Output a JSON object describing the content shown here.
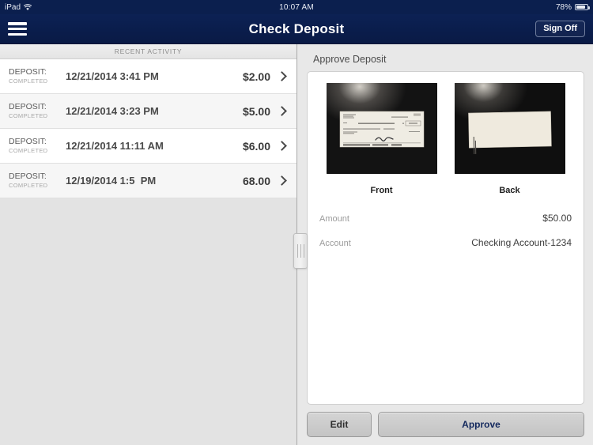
{
  "status_bar": {
    "device": "iPad",
    "wifi_icon": "wifi-icon",
    "time": "10:07 AM",
    "battery_percent": "78%",
    "battery_icon": "battery-icon"
  },
  "nav_bar": {
    "menu_icon": "hamburger-menu-icon",
    "title": "Check Deposit",
    "sign_off_label": "Sign Off"
  },
  "left_pane": {
    "section_header": "RECENT ACTIVITY",
    "rows": [
      {
        "type": "DEPOSIT:",
        "state": "COMPLETED",
        "date": "12/21/2014 3:41 PM",
        "amount": "$2.00",
        "chevron_icon": "chevron-right-icon"
      },
      {
        "type": "DEPOSIT:",
        "state": "COMPLETED",
        "date": "12/21/2014 3:23 PM",
        "amount": "$5.00",
        "chevron_icon": "chevron-right-icon"
      },
      {
        "type": "DEPOSIT:",
        "state": "COMPLETED",
        "date": "12/21/2014 11:11 AM",
        "amount": "$6.00",
        "chevron_icon": "chevron-right-icon"
      },
      {
        "type": "DEPOSIT:",
        "state": "COMPLETED",
        "date": "12/19/2014 1:5  PM",
        "amount": "68.00",
        "chevron_icon": "chevron-right-icon"
      }
    ]
  },
  "splitter": {
    "icon": "drag-handle-icon"
  },
  "right_pane": {
    "title": "Approve Deposit",
    "thumbnails": [
      {
        "label": "Front",
        "image_name": "check-front-image"
      },
      {
        "label": "Back",
        "image_name": "check-back-image"
      }
    ],
    "fields": [
      {
        "label": "Amount",
        "value": "$50.00"
      },
      {
        "label": "Account",
        "value": "Checking Account-1234"
      }
    ],
    "buttons": {
      "edit_label": "Edit",
      "approve_label": "Approve"
    }
  },
  "colors": {
    "navy": "#0b1f4e",
    "approve_text": "#14295e",
    "pane_bg": "#e8e8e8",
    "row_white": "#ffffff",
    "row_alt": "#f6f6f6"
  }
}
